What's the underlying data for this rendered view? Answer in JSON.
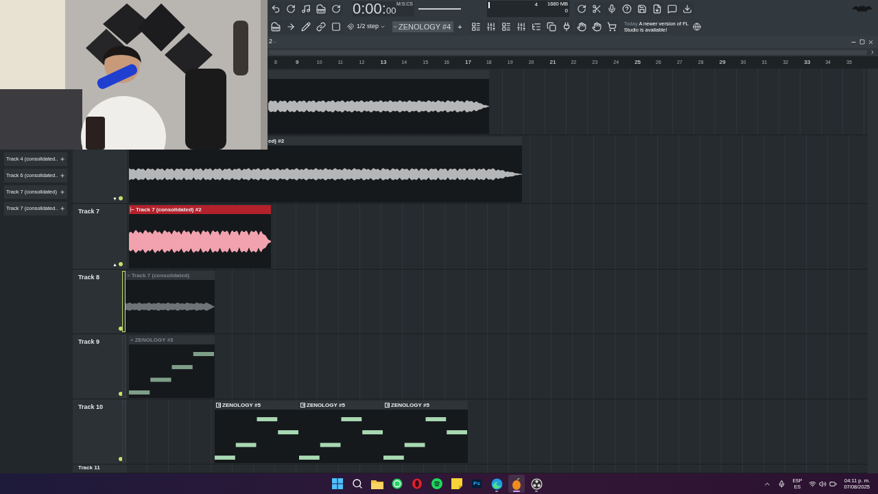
{
  "toolbar": {
    "time": {
      "main": "0:00:",
      "small": "00",
      "unit": "M:S:CS"
    },
    "monitor": {
      "value": "4",
      "memory": "1680 MB",
      "polyphony": "0"
    },
    "snap": "1/2 step",
    "pattern": "ZENOLOGY #4",
    "add": "+",
    "hint": {
      "title": "Today",
      "text": "A newer version of FL Studio is available!"
    }
  },
  "playlist": {
    "arrangement": "2",
    "ruler": [
      "8",
      "9",
      "10",
      "11",
      "12",
      "13",
      "14",
      "15",
      "16",
      "17",
      "18",
      "19",
      "20",
      "21",
      "22",
      "23",
      "24",
      "25",
      "26",
      "27",
      "28",
      "29",
      "30",
      "31",
      "32",
      "33",
      "34",
      "35"
    ]
  },
  "picker": [
    "Track 4 (consolidated..",
    "Track 6 (consolidated..",
    "Track 7 (consolidated)",
    "Track 7 (consolidated.."
  ],
  "tracks": [
    {
      "clips": [
        {
          "kind": "audio",
          "muted": false
        }
      ]
    },
    {
      "arrow": "▼",
      "clips": [
        {
          "kind": "audio",
          "label": "ed) #2",
          "muted": false
        }
      ]
    },
    {
      "label": "Track 7",
      "arrow": "▲",
      "clips": [
        {
          "kind": "audio",
          "label": "Track 7 (consolidated) #2",
          "muted": false,
          "color": "#b3222c"
        }
      ]
    },
    {
      "label": "Track 8",
      "selected": true,
      "clips": [
        {
          "kind": "audio",
          "mark": "×",
          "label": "Track 7 (consolidated)",
          "muted": true
        }
      ]
    },
    {
      "label": "Track 9",
      "selected": false,
      "clips": [
        {
          "kind": "pattern",
          "mark": "×",
          "label": "ZENOLOGY #3",
          "muted": true
        }
      ]
    },
    {
      "label": "Track 10",
      "selected": false,
      "clips": [
        {
          "kind": "pattern",
          "label": "ZENOLOGY #5",
          "muted": false
        },
        {
          "kind": "pattern",
          "label": "ZENOLOGY #5",
          "muted": false
        },
        {
          "kind": "pattern",
          "label": "ZENOLOGY #5",
          "muted": false
        }
      ]
    },
    {
      "label": "Track 11"
    }
  ],
  "taskbar": {
    "apps": [
      {
        "kind": "start",
        "running": false,
        "selected": false
      },
      {
        "kind": "search",
        "running": false,
        "selected": false
      },
      {
        "kind": "files",
        "running": false,
        "selected": false
      },
      {
        "kind": "chat",
        "running": false,
        "selected": false
      },
      {
        "kind": "browser-o",
        "running": false,
        "selected": false
      },
      {
        "kind": "music",
        "running": false,
        "selected": false
      },
      {
        "kind": "notes",
        "running": false,
        "selected": false
      },
      {
        "kind": "ps",
        "text": "Ps",
        "running": false,
        "selected": false
      },
      {
        "kind": "edge",
        "running": true,
        "selected": false
      },
      {
        "kind": "daw",
        "running": true,
        "selected": true
      },
      {
        "kind": "recorder",
        "running": true,
        "selected": false
      }
    ],
    "language": {
      "top": "ESP",
      "bottom": "ES"
    },
    "time": "04:11 p. m.",
    "date": "07/08/2025"
  }
}
